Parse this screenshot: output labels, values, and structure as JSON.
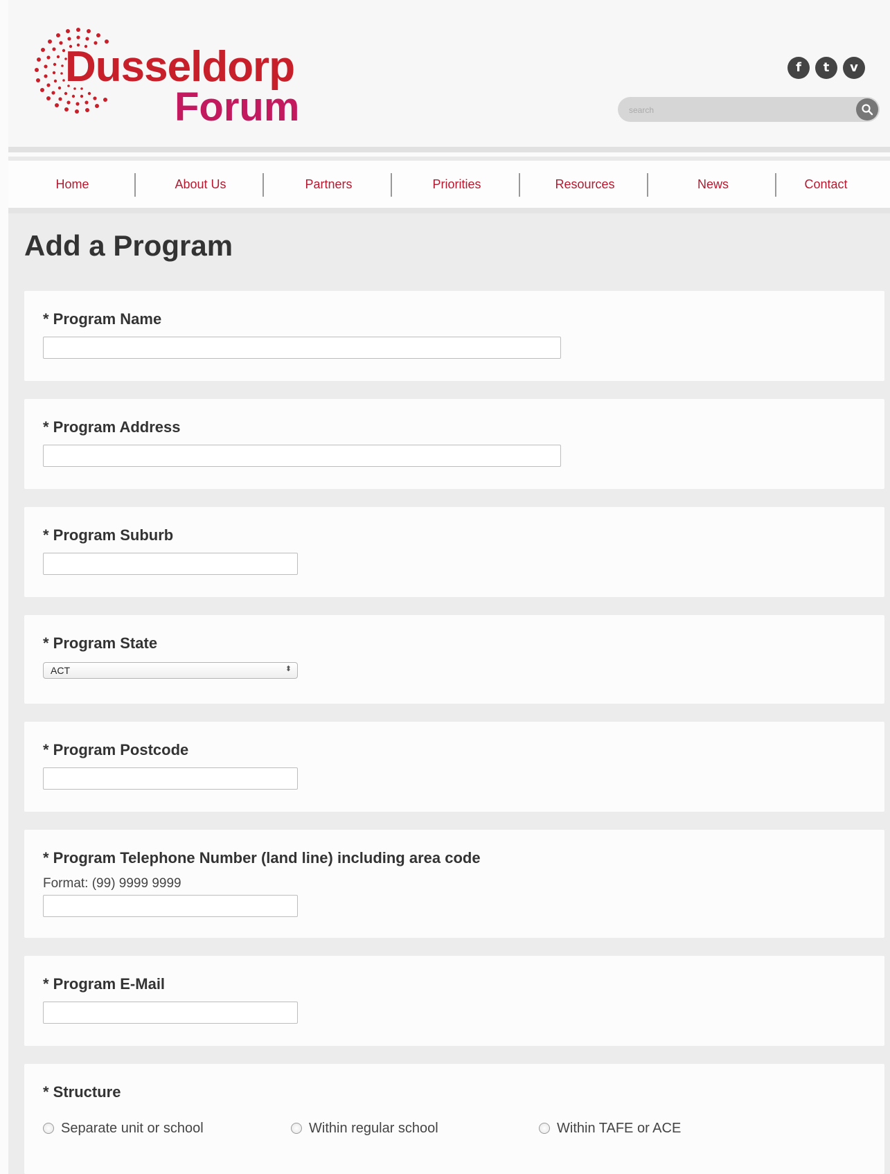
{
  "header": {
    "logo": {
      "line1": "Dusseldorp",
      "line2": "Forum"
    },
    "social": [
      {
        "icon": "facebook-icon",
        "glyph": "f"
      },
      {
        "icon": "twitter-icon",
        "glyph": "t"
      },
      {
        "icon": "vimeo-icon",
        "glyph": "v"
      }
    ],
    "search": {
      "placeholder": "search",
      "value": ""
    }
  },
  "nav": {
    "items": [
      {
        "label": "Home"
      },
      {
        "label": "About Us"
      },
      {
        "label": "Partners"
      },
      {
        "label": "Priorities"
      },
      {
        "label": "Resources"
      },
      {
        "label": "News"
      },
      {
        "label": "Contact"
      }
    ]
  },
  "page": {
    "title": "Add a Program"
  },
  "form": {
    "program_name": {
      "label": "* Program Name",
      "value": ""
    },
    "program_address": {
      "label": "* Program Address",
      "value": ""
    },
    "program_suburb": {
      "label": "* Program Suburb",
      "value": ""
    },
    "program_state": {
      "label": "* Program State",
      "selected": "ACT"
    },
    "program_postcode": {
      "label": "* Program Postcode",
      "value": ""
    },
    "program_telephone": {
      "label": "* Program Telephone Number (land line) including area code",
      "help": "Format: (99) 9999 9999",
      "value": ""
    },
    "program_email": {
      "label": "* Program E-Mail",
      "value": ""
    },
    "structure": {
      "label": "* Structure",
      "options": [
        {
          "label": "Separate unit or school",
          "checked": false
        },
        {
          "label": "Within regular school",
          "checked": false
        },
        {
          "label": "Within TAFE or ACE",
          "checked": false
        }
      ]
    }
  },
  "colors": {
    "logo_red": "#c8202a",
    "logo_magenta": "#c2195f",
    "nav_text": "#b5192f",
    "content_bg": "#ececec",
    "card_bg": "#fcfcfc"
  }
}
